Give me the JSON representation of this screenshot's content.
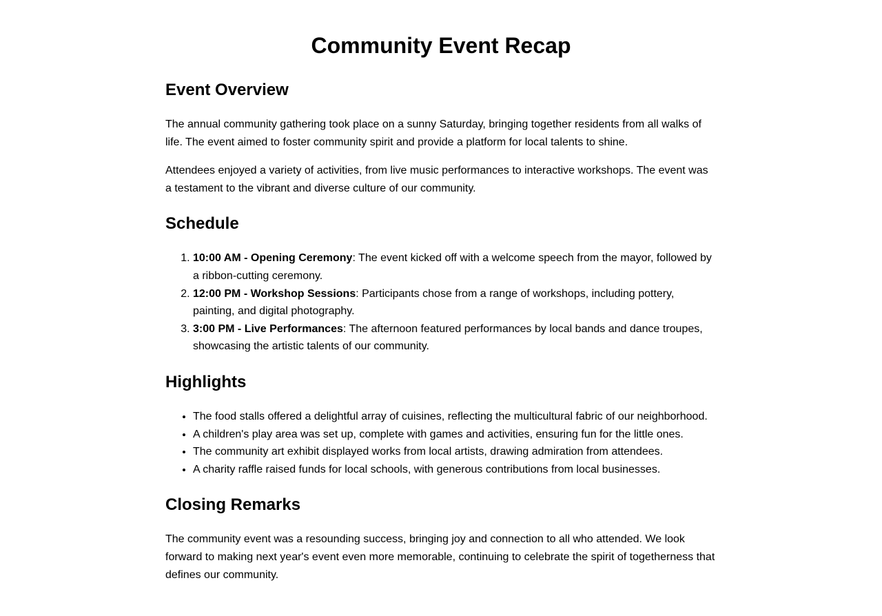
{
  "title": "Community Event Recap",
  "overview": {
    "heading": "Event Overview",
    "paragraphs": [
      "The annual community gathering took place on a sunny Saturday, bringing together residents from all walks of life. The event aimed to foster community spirit and provide a platform for local talents to shine.",
      "Attendees enjoyed a variety of activities, from live music performances to interactive workshops. The event was a testament to the vibrant and diverse culture of our community."
    ]
  },
  "schedule": {
    "heading": "Schedule",
    "items": [
      {
        "title": "10:00 AM - Opening Ceremony",
        "text": ": The event kicked off with a welcome speech from the mayor, followed by a ribbon-cutting ceremony."
      },
      {
        "title": "12:00 PM - Workshop Sessions",
        "text": ": Participants chose from a range of workshops, including pottery, painting, and digital photography."
      },
      {
        "title": "3:00 PM - Live Performances",
        "text": ": The afternoon featured performances by local bands and dance troupes, showcasing the artistic talents of our community."
      }
    ]
  },
  "highlights": {
    "heading": "Highlights",
    "items": [
      "The food stalls offered a delightful array of cuisines, reflecting the multicultural fabric of our neighborhood.",
      "A children's play area was set up, complete with games and activities, ensuring fun for the little ones.",
      "The community art exhibit displayed works from local artists, drawing admiration from attendees.",
      "A charity raffle raised funds for local schools, with generous contributions from local businesses."
    ]
  },
  "closing": {
    "heading": "Closing Remarks",
    "paragraphs": [
      "The community event was a resounding success, bringing joy and connection to all who attended. We look forward to making next year's event even more memorable, continuing to celebrate the spirit of togetherness that defines our community."
    ]
  }
}
